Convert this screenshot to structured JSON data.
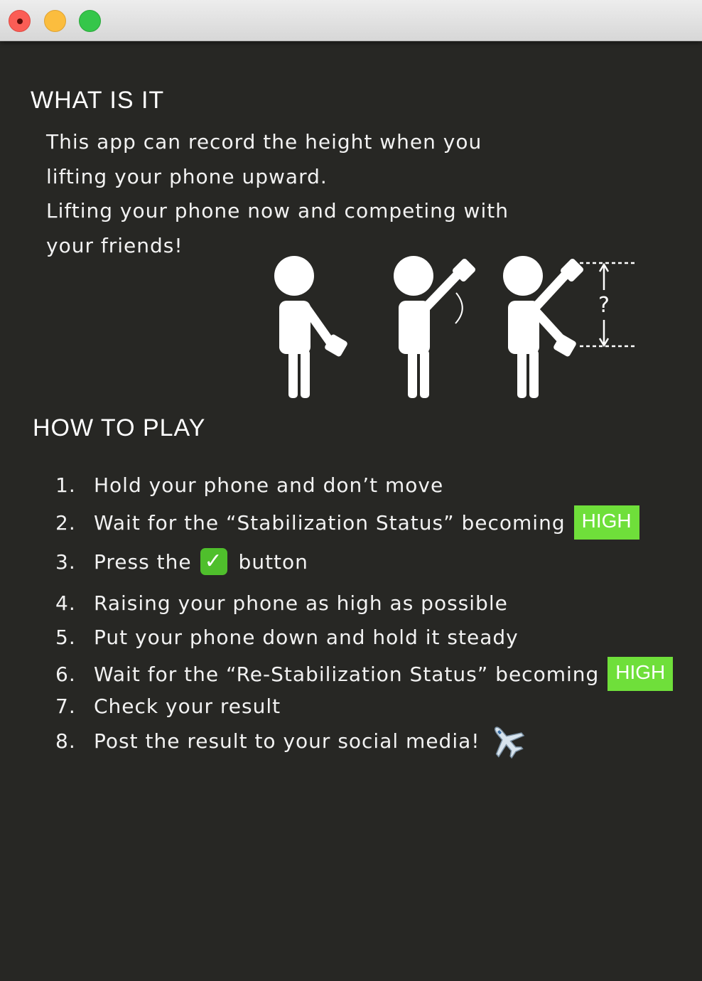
{
  "window": {
    "controls": [
      "close-button",
      "minimize-button",
      "zoom-button"
    ]
  },
  "what_is_it": {
    "title": "WHAT IS IT",
    "lines": [
      "This app can record the height when you",
      "lifting your phone upward.",
      "Lifting your phone now and competing with",
      "your friends!"
    ]
  },
  "illustration": {
    "question_mark": "?"
  },
  "how_to_play": {
    "title": "HOW TO PLAY",
    "steps": [
      {
        "num": "1.",
        "text": "Hold your phone and don’t move"
      },
      {
        "num": "2.",
        "text": "Wait for the “Stabilization Status” becoming",
        "badge": "HIGH"
      },
      {
        "num": "3.",
        "text_before": "Press the",
        "icon": "check-button-icon",
        "text_after": "button"
      },
      {
        "num": "4.",
        "text": "Raising your phone as high as possible"
      },
      {
        "num": "5.",
        "text": "Put your phone down and hold it steady"
      },
      {
        "num": "6.",
        "text": "Wait for the “Re-Stabilization Status” becoming",
        "badge": "HIGH"
      },
      {
        "num": "7.",
        "text": "Check your result"
      },
      {
        "num": "8.",
        "text": "Post the result to your social media!",
        "icon": "airplane-icon"
      }
    ]
  },
  "colors": {
    "background": "#272724",
    "badge": "#6fdf3a",
    "checkbox": "#4fbf2c"
  }
}
